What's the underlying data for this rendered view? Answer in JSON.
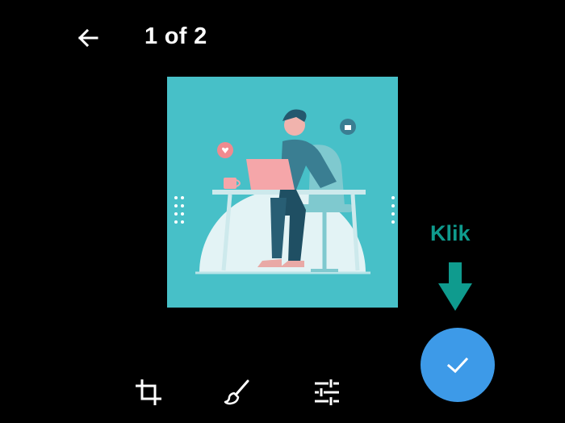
{
  "header": {
    "back_icon": "arrow-left-icon",
    "counter": "1 of 2"
  },
  "preview": {
    "description_icon": "person-at-laptop-illustration",
    "background_color": "#47c0c8"
  },
  "annotation": {
    "label": "Klik",
    "color": "#0f9b8e",
    "arrow_icon": "arrow-down-icon"
  },
  "confirm": {
    "icon": "check-icon",
    "color": "#3d9ae8"
  },
  "toolbar": {
    "items": [
      {
        "name": "crop",
        "icon": "crop-icon"
      },
      {
        "name": "draw",
        "icon": "brush-icon"
      },
      {
        "name": "adjust",
        "icon": "sliders-icon"
      }
    ]
  }
}
